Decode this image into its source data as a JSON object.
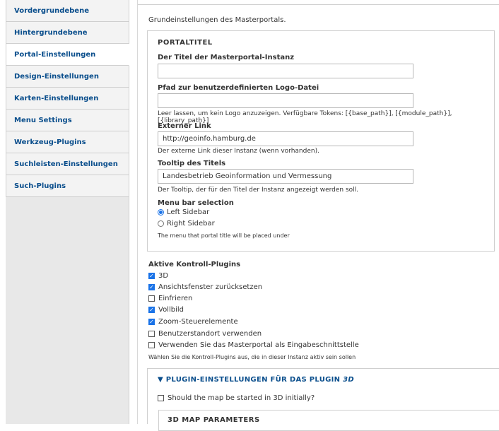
{
  "sidebar": {
    "items": [
      {
        "label": "Vordergrundebene"
      },
      {
        "label": "Hintergrundebene"
      },
      {
        "label": "Portal-Einstellungen"
      },
      {
        "label": "Design-Einstellungen"
      },
      {
        "label": "Karten-Einstellungen"
      },
      {
        "label": "Menu Settings"
      },
      {
        "label": "Werkzeug-Plugins"
      },
      {
        "label": "Suchleisten-Einstellungen"
      },
      {
        "label": "Such-Plugins"
      }
    ],
    "active_index": 2,
    "highlight_color": "#fff200"
  },
  "main": {
    "description": "Grundeinstellungen des Masterportals.",
    "portaltitel": {
      "legend": "PORTALTITEL",
      "title_label": "Der Titel der Masterportal-Instanz",
      "title_value": "",
      "logo_label": "Pfad zur benutzerdefinierten Logo-Datei",
      "logo_value": "",
      "logo_hint": "Leer lassen, um kein Logo anzuzeigen. Verfügbare Tokens: [{base_path}], [{module_path}], [{library_path}]",
      "link_label": "Externer Link",
      "link_value": "http://geoinfo.hamburg.de",
      "link_hint": "Der externe Link dieser Instanz (wenn vorhanden).",
      "tooltip_label": "Tooltip des Titels",
      "tooltip_value": "Landesbetrieb Geoinformation und Vermessung",
      "tooltip_hint": "Der Tooltip, der für den Titel der Instanz angezeigt werden soll.",
      "menubar_label": "Menu bar selection",
      "menubar_options": [
        {
          "label": "Left Sidebar",
          "selected": true
        },
        {
          "label": "Right Sidebar",
          "selected": false
        }
      ],
      "menubar_hint": "The menu that portal title will be placed under"
    },
    "kontroll": {
      "label": "Aktive Kontroll-Plugins",
      "items": [
        {
          "label": "3D",
          "checked": true
        },
        {
          "label": "Ansichtsfenster zurücksetzen",
          "checked": true
        },
        {
          "label": "Einfrieren",
          "checked": false
        },
        {
          "label": "Vollbild",
          "checked": true
        },
        {
          "label": "Zoom-Steuerelemente",
          "checked": true
        },
        {
          "label": "Benutzerstandort verwenden",
          "checked": false
        },
        {
          "label": "Verwenden Sie das Masterportal als Eingabeschnittstelle",
          "checked": false
        }
      ],
      "hint": "Wählen Sie die Kontroll-Plugins aus, die in dieser Instanz aktiv sein sollen"
    },
    "plugin": {
      "title_prefix": "▼ PLUGIN-EINSTELLUNGEN FÜR DAS PLUGIN ",
      "title_plugin": "3D",
      "checkbox_label": "Should the map be started in 3D initially?",
      "checkbox_checked": false,
      "inner_title": "3D MAP PARAMETERS"
    }
  }
}
